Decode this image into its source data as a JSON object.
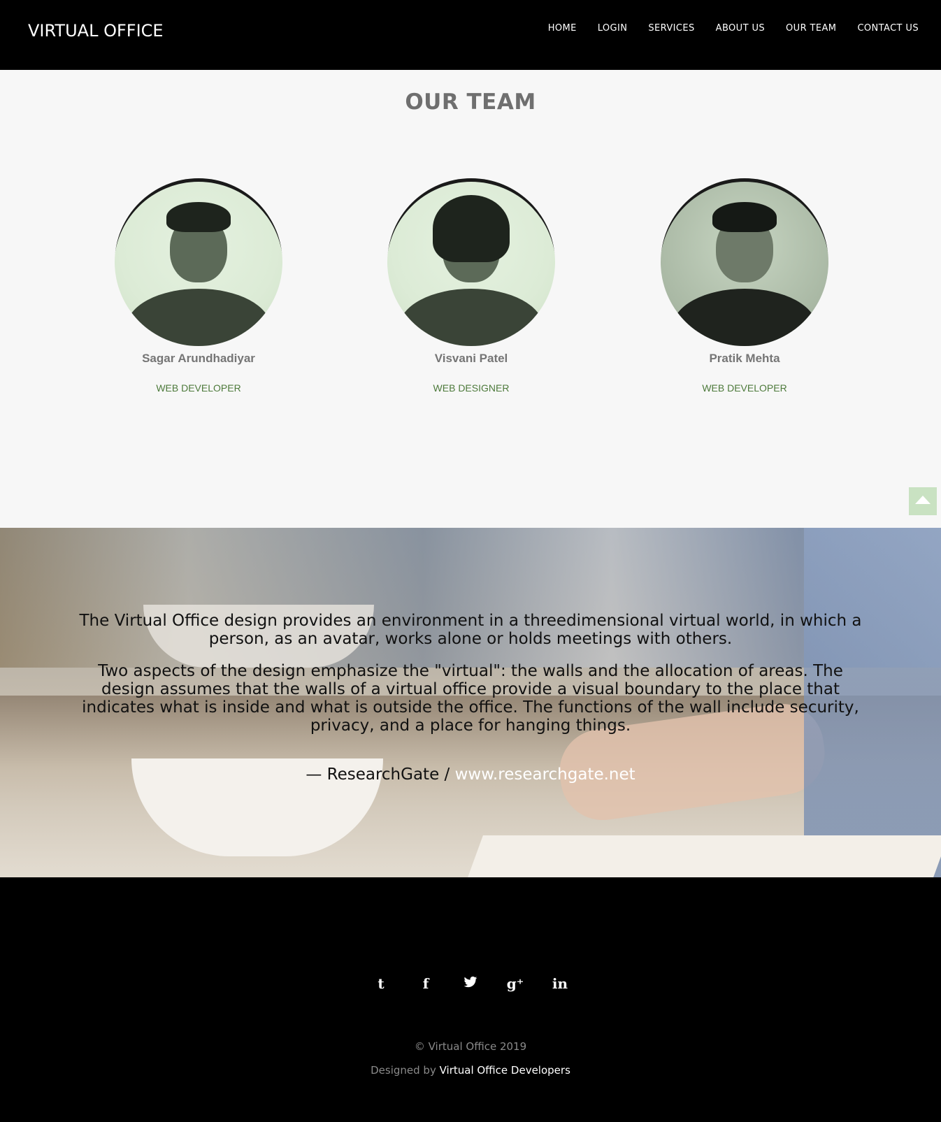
{
  "header": {
    "brand": "VIRTUAL OFFICE",
    "nav": [
      "HOME",
      "LOGIN",
      "SERVICES",
      "ABOUT US",
      "OUR TEAM",
      "CONTACT US"
    ]
  },
  "team": {
    "title": "OUR TEAM",
    "members": [
      {
        "name": "Sagar Arundhadiyar",
        "role": "WEB DEVELOPER"
      },
      {
        "name": "Visvani Patel",
        "role": "WEB DESIGNER"
      },
      {
        "name": "Pratik Mehta",
        "role": "WEB DEVELOPER"
      }
    ],
    "scroll_top_icon": "chevron-up-icon"
  },
  "quote": {
    "paragraph1": "The Virtual Office design provides an environment in a threedimensional virtual world, in which a person, as an avatar, works alone or holds meetings with others.",
    "paragraph2": "Two aspects of the design emphasize the \"virtual\": the walls and the allocation of areas. The design assumes that the walls of a virtual office provide a visual boundary to the place that indicates what is inside and what is outside the office. The functions of the wall include security, privacy, and a place for hanging things.",
    "cite_prefix": "— ResearchGate / ",
    "cite_link": "www.researchgate.net"
  },
  "footer": {
    "social": [
      {
        "icon": "tumblr-icon",
        "glyph": "t"
      },
      {
        "icon": "facebook-icon",
        "glyph": "f"
      },
      {
        "icon": "twitter-icon",
        "glyph": "🐦"
      },
      {
        "icon": "google-plus-icon",
        "glyph": "g⁺"
      },
      {
        "icon": "linkedin-icon",
        "glyph": "in"
      }
    ],
    "copyright": "© Virtual Office 2019",
    "designed_prefix": "Designed by ",
    "designed_link": "Virtual Office Developers"
  },
  "colors": {
    "accent_green": "#4d7a3b",
    "scroll_top_bg": "#c9e2c2"
  }
}
